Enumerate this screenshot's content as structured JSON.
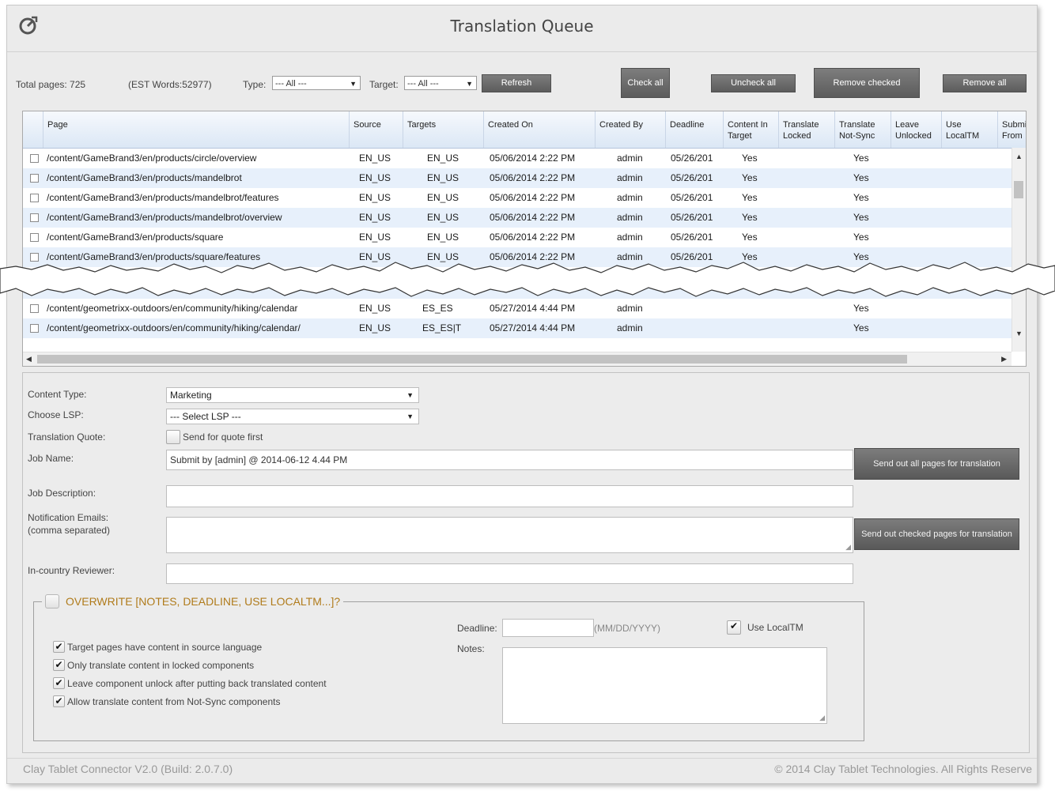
{
  "window": {
    "title": "Translation Queue"
  },
  "filters": {
    "total_pages": "Total pages: 725",
    "est_words": "(EST Words:52977)",
    "type_label": "Type:",
    "type_value": "--- All ---",
    "target_label": "Target:",
    "target_value": "--- All ---",
    "refresh": "Refresh",
    "check_all": "Check all",
    "uncheck_all": "Uncheck all",
    "remove_checked": "Remove checked",
    "remove_all": "Remove all"
  },
  "table": {
    "headers": [
      "Page",
      "Source",
      "Targets",
      "Created On",
      "Created By",
      "Deadline",
      "Content In Target",
      "Translate Locked",
      "Translate Not-Sync",
      "Leave Unlocked",
      "Use LocalTM",
      "Submit From"
    ],
    "rows": [
      {
        "page": "/content/GameBrand3/en/products/circle/overview",
        "source": "EN_US",
        "targets": "EN_US",
        "created_on": "05/06/2014 2:22 PM",
        "created_by": "admin",
        "deadline": "05/26/201",
        "content_in_target": "Yes",
        "translate_not_sync": "Yes"
      },
      {
        "page": "/content/GameBrand3/en/products/mandelbrot",
        "source": "EN_US",
        "targets": "EN_US",
        "created_on": "05/06/2014 2:22 PM",
        "created_by": "admin",
        "deadline": "05/26/201",
        "content_in_target": "Yes",
        "translate_not_sync": "Yes"
      },
      {
        "page": "/content/GameBrand3/en/products/mandelbrot/features",
        "source": "EN_US",
        "targets": "EN_US",
        "created_on": "05/06/2014 2:22 PM",
        "created_by": "admin",
        "deadline": "05/26/201",
        "content_in_target": "Yes",
        "translate_not_sync": "Yes"
      },
      {
        "page": "/content/GameBrand3/en/products/mandelbrot/overview",
        "source": "EN_US",
        "targets": "EN_US",
        "created_on": "05/06/2014 2:22 PM",
        "created_by": "admin",
        "deadline": "05/26/201",
        "content_in_target": "Yes",
        "translate_not_sync": "Yes"
      },
      {
        "page": "/content/GameBrand3/en/products/square",
        "source": "EN_US",
        "targets": "EN_US",
        "created_on": "05/06/2014 2:22 PM",
        "created_by": "admin",
        "deadline": "05/26/201",
        "content_in_target": "Yes",
        "translate_not_sync": "Yes"
      },
      {
        "page": "/content/GameBrand3/en/products/square/features",
        "source": "EN_US",
        "targets": "EN_US",
        "created_on": "05/06/2014 2:22 PM",
        "created_by": "admin",
        "deadline": "05/26/201",
        "content_in_target": "Yes",
        "translate_not_sync": "Yes"
      },
      {
        "page": "/content/geometrixx-outdoors/en/community/hiking/calendar",
        "source": "EN_US",
        "targets": "ES_ES",
        "created_on": "05/27/2014 4:44 PM",
        "created_by": "admin",
        "deadline": "",
        "content_in_target": "",
        "translate_not_sync": "Yes"
      },
      {
        "page": "/content/geometrixx-outdoors/en/community/hiking/calendar/",
        "source": "EN_US",
        "targets": "ES_ES|T",
        "created_on": "05/27/2014 4:44 PM",
        "created_by": "admin",
        "deadline": "",
        "content_in_target": "",
        "translate_not_sync": "Yes"
      }
    ]
  },
  "form": {
    "content_type_label": "Content Type:",
    "content_type_value": "Marketing",
    "lsp_label": "Choose LSP:",
    "lsp_value": "--- Select LSP ---",
    "quote_label": "Translation Quote:",
    "quote_checkbox": "Send for quote first",
    "job_name_label": "Job Name:",
    "job_name_value": "Submit by [admin] @ 2014-06-12 4.44 PM",
    "job_desc_label": "Job Description:",
    "notif_label": "Notification Emails:",
    "notif_sub": "(comma separated)",
    "reviewer_label": "In-country Reviewer:",
    "send_all": "Send out all pages for translation",
    "send_checked": "Send out checked pages for translation",
    "overwrite_label": "OVERWRITE [NOTES, DEADLINE, USE LOCALTM...]?",
    "opt1": "Target pages have content in source language",
    "opt2": "Only translate content in locked components",
    "opt3": "Leave component unlock after putting back translated content",
    "opt4": "Allow translate content from Not-Sync components",
    "deadline_label": "Deadline:",
    "deadline_hint": "(MM/DD/YYYY)",
    "use_localtm": "Use LocalTM",
    "notes_label": "Notes:"
  },
  "footer": {
    "left": "Clay Tablet Connector  V2.0 (Build: 2.0.7.0)",
    "right": "© 2014 Clay Tablet Technologies. All Rights Reserve"
  }
}
